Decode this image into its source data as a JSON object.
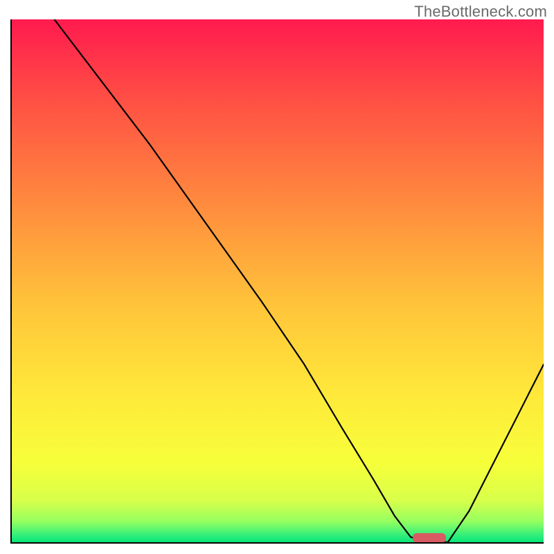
{
  "watermark": "TheBottleneck.com",
  "colors": {
    "gradient_top": "#ff1a4e",
    "gradient_upper_mid": "#ffa23e",
    "gradient_mid": "#ffd83a",
    "gradient_lower": "#f8ff3a",
    "gradient_bottom": "#06e67a",
    "marker": "#d85a63",
    "axis": "#000000"
  },
  "chart_data": {
    "type": "line",
    "title": "",
    "xlabel": "",
    "ylabel": "",
    "xlim": [
      0,
      100
    ],
    "ylim": [
      0,
      100
    ],
    "grid": false,
    "legend": false,
    "series": [
      {
        "name": "bottleneck-curve",
        "x": [
          8,
          14,
          20,
          26,
          33,
          40,
          47,
          55,
          62,
          68,
          72,
          75,
          78,
          82,
          86,
          90,
          94,
          97,
          100
        ],
        "y": [
          100,
          92,
          84,
          76,
          66,
          56,
          46,
          34,
          22,
          12,
          5,
          1,
          0,
          0,
          6,
          14,
          22,
          28,
          34
        ]
      }
    ],
    "annotations": [
      {
        "name": "optimal-marker",
        "x": 78.5,
        "y": 0.8,
        "shape": "rounded-bar"
      }
    ]
  }
}
